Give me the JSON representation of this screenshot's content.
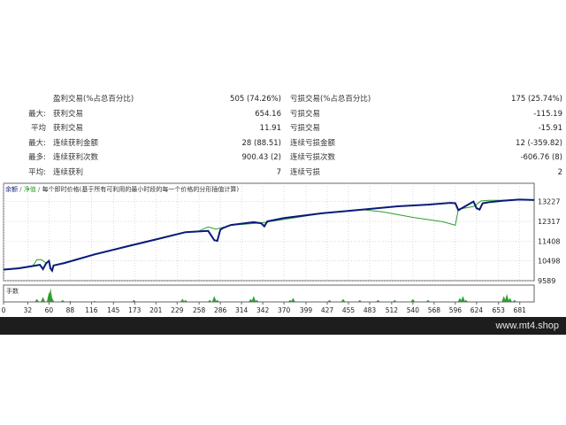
{
  "stats": {
    "rows": [
      {
        "prefix": "",
        "label": "盈利交易(%占总百分比)",
        "value": "505 (74.26%)",
        "label2": "亏损交易(%占总百分比)",
        "value2": "175 (25.74%)"
      },
      {
        "prefix": "最大:",
        "label": "获利交易",
        "value": "654.16",
        "label2": "亏损交易",
        "value2": "-115.19"
      },
      {
        "prefix": "平均",
        "label": "获利交易",
        "value": "11.91",
        "label2": "亏损交易",
        "value2": "-15.91"
      },
      {
        "prefix": "最大:",
        "label": "连续获利金额",
        "value": "28 (88.51)",
        "label2": "连续亏损金额",
        "value2": "12 (-359.82)"
      },
      {
        "prefix": "最多:",
        "label": "连续获利次数",
        "value": "900.43 (2)",
        "label2": "连续亏损次数",
        "value2": "-606.76 (8)"
      },
      {
        "prefix": "平均:",
        "label": "连续获利",
        "value": "7",
        "label2": "连续亏损",
        "value2": "2"
      }
    ]
  },
  "footer": {
    "site": "www.mt4.shop"
  },
  "chart_data": {
    "type": "line",
    "legend": {
      "balance_label": "余额",
      "equity_label": "净值",
      "description": "每个即时价格(基于所有可利用的最小时段的每一个价格的分形插值计算)"
    },
    "colors": {
      "balance": "#0a1a7a",
      "equity": "#2e9d2e",
      "volume": "#2e9d2e",
      "grid": "#c8c8c8",
      "axis": "#666666"
    },
    "grid": true,
    "legend_position": "top-left",
    "ylim": [
      9589,
      13500
    ],
    "y_ticks": [
      13227,
      12317,
      11408,
      10498,
      9589
    ],
    "xlim": [
      0,
      700
    ],
    "x_ticks": [
      0,
      32,
      60,
      88,
      116,
      145,
      173,
      201,
      229,
      258,
      286,
      314,
      342,
      370,
      399,
      427,
      455,
      483,
      512,
      540,
      568,
      596,
      624,
      653,
      681
    ],
    "balance": {
      "x": [
        0,
        20,
        38,
        48,
        52,
        56,
        60,
        62,
        64,
        66,
        80,
        120,
        160,
        200,
        240,
        270,
        278,
        282,
        286,
        290,
        300,
        330,
        340,
        344,
        348,
        370,
        420,
        470,
        520,
        560,
        590,
        596,
        600,
        620,
        624,
        628,
        632,
        640,
        660,
        680,
        700
      ],
      "y": [
        10100,
        10160,
        10260,
        10320,
        10120,
        10380,
        10500,
        10150,
        10050,
        10290,
        10400,
        10800,
        11140,
        11480,
        11820,
        11880,
        11450,
        11420,
        11930,
        12020,
        12150,
        12280,
        12230,
        12090,
        12320,
        12470,
        12690,
        12850,
        13010,
        13090,
        13170,
        13150,
        12830,
        13230,
        12920,
        12860,
        13150,
        13200,
        13270,
        13320,
        13300
      ]
    },
    "equity": {
      "x": [
        0,
        20,
        38,
        44,
        50,
        56,
        60,
        62,
        64,
        66,
        80,
        120,
        160,
        200,
        240,
        258,
        270,
        280,
        300,
        340,
        420,
        470,
        500,
        540,
        580,
        596,
        600,
        620,
        630,
        640,
        660,
        680,
        700
      ],
      "y": [
        10080,
        10140,
        10240,
        10560,
        10560,
        10400,
        10520,
        10160,
        10080,
        10300,
        10380,
        10780,
        11120,
        11460,
        11800,
        11880,
        12060,
        11960,
        12140,
        12250,
        12680,
        12870,
        12760,
        12500,
        12300,
        12140,
        12880,
        13000,
        13260,
        13290,
        13290,
        13320,
        13300
      ]
    },
    "volume_label": "手数",
    "volume": {
      "x": [
        44,
        52,
        60,
        62,
        64,
        78,
        88,
        120,
        172,
        236,
        240,
        272,
        278,
        282,
        326,
        330,
        334,
        378,
        382,
        430,
        448,
        470,
        494,
        516,
        540,
        560,
        602,
        606,
        610,
        660,
        664,
        668,
        674
      ],
      "y": [
        3,
        5,
        10,
        14,
        4,
        2,
        1,
        1,
        2,
        3,
        2,
        2,
        6,
        2,
        3,
        6,
        2,
        2,
        4,
        2,
        3,
        2,
        2,
        2,
        3,
        2,
        4,
        6,
        2,
        6,
        8,
        4,
        2
      ]
    },
    "volume_ymax": 16
  }
}
